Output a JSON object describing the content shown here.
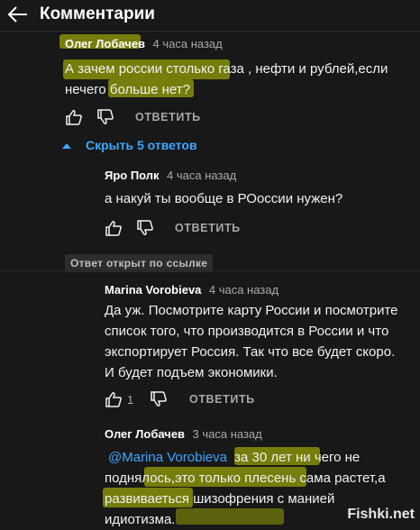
{
  "header": {
    "title": "Комментарии",
    "back_icon": "arrow-left-icon"
  },
  "colors": {
    "background": "#181818",
    "link": "#3ea6ff",
    "highlight": "#c4d200"
  },
  "comments": [
    {
      "author": "Олег Лобачев",
      "time": "4 часа назад",
      "text_lines": [
        "А зачем россии столько газа , нефти и рублей,если",
        "нечего больше нет?"
      ],
      "likes": "",
      "reply_label": "ОТВЕТИТЬ"
    }
  ],
  "replies_toggle": {
    "label": "Скрыть 5 ответов",
    "icon": "chevron-up-icon"
  },
  "replies": [
    {
      "author": "Яро Полк",
      "time": "4 часа назад",
      "text_lines": [
        "а накуй ты вообще в РОоссии нужен?"
      ],
      "likes": "",
      "reply_label": "ОТВЕТИТЬ"
    },
    {
      "badge": "Ответ открыт по ссылке",
      "author": "Marina Vorobieva",
      "time": "4 часа назад",
      "text_lines": [
        "Да уж. Посмотрите карту России и посмотрите",
        "список того, что производится в России и что",
        "экспортирует Россия. Так что все будет скоро.",
        "И будет подъем экономики."
      ],
      "likes": "1",
      "reply_label": "ОТВЕТИТЬ"
    },
    {
      "author": "Олег Лобачев",
      "time": "3 часа назад",
      "mention": "@Marina Vorobieva",
      "text_first": "за 30 лет ни чего не",
      "text_lines": [
        "поднялось,это только плесень сама растет,а",
        "развиваеться шизофрения с манией",
        "идиотизма."
      ]
    }
  ],
  "watermark": "Fishki.net"
}
